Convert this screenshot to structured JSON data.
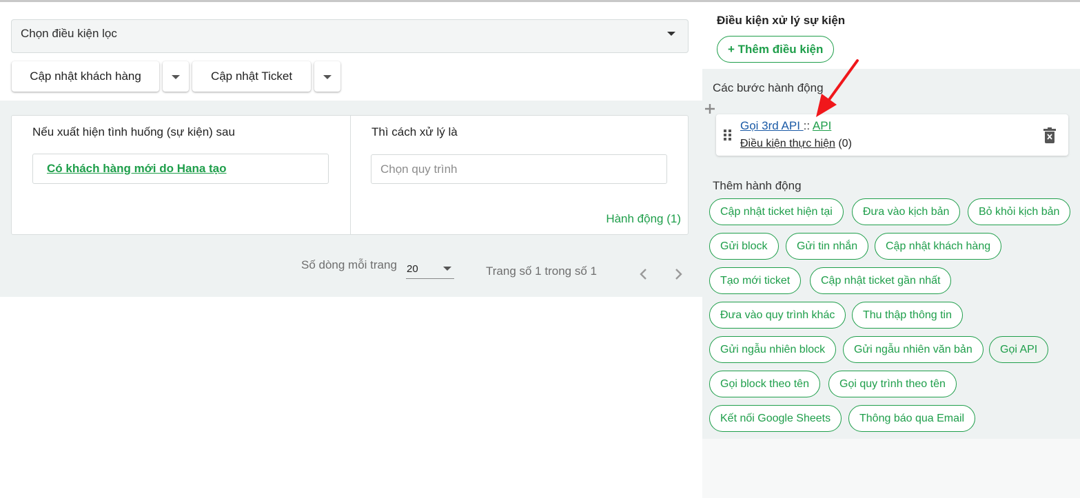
{
  "filter": {
    "placeholder": "Chọn điều kiện lọc"
  },
  "buttons": {
    "update_customer": "Cập nhật khách hàng",
    "update_ticket": "Cập nhật Ticket"
  },
  "rule_card": {
    "if_heading": "Nếu xuất hiện tình huống (sự kiện) sau",
    "then_heading": "Thì cách xử lý là",
    "event_link": "Có khách hàng mới do Hana tạo",
    "flow_placeholder": "Chọn quy trình",
    "action_count": "Hành động (1)"
  },
  "pagination": {
    "rows_label": "Số dòng mỗi trang",
    "rows_value": "20",
    "page_info": "Trang số 1 trong số 1"
  },
  "right_panel": {
    "conditions_title": "Điều kiện xử lý sự kiện",
    "add_condition": "+ Thêm điều kiện",
    "steps_title": "Các bước hành động",
    "step": {
      "name": "Gọi 3rd API ",
      "separator": " :: ",
      "type": "API",
      "condition_label": "Điều kiện thực hiện",
      "condition_count": " (0)"
    },
    "add_action_title": "Thêm hành động",
    "actions": [
      "Cập nhật ticket hiện tại",
      "Đưa vào kịch bản",
      "Bỏ khỏi kịch bản",
      "Gửi block",
      "Gửi tin nhắn",
      "Cập nhật khách hàng",
      "Tạo mới ticket",
      "Cập nhật ticket gần nhất",
      "Đưa vào quy trình khác",
      "Thu thập thông tin",
      "Gửi ngẫu nhiên block",
      "Gửi ngẫu nhiên văn bản",
      "Gọi API",
      "Gọi block theo tên",
      "Gọi quy trình theo tên",
      "Kết nối Google Sheets",
      "Thông báo qua Email"
    ]
  },
  "icons": {
    "caret": "caret-down-icon",
    "prev": "chevron-left-icon",
    "next": "chevron-right-icon",
    "plus": "plus-icon",
    "drag": "drag-handle-icon",
    "trash": "delete-icon",
    "annotation": "red-arrow-icon"
  },
  "colors": {
    "accent_green": "#1e9e4a",
    "link_blue": "#1a5aa6",
    "annotation_red": "#f0171b",
    "panel_grey": "#eef2f2"
  }
}
